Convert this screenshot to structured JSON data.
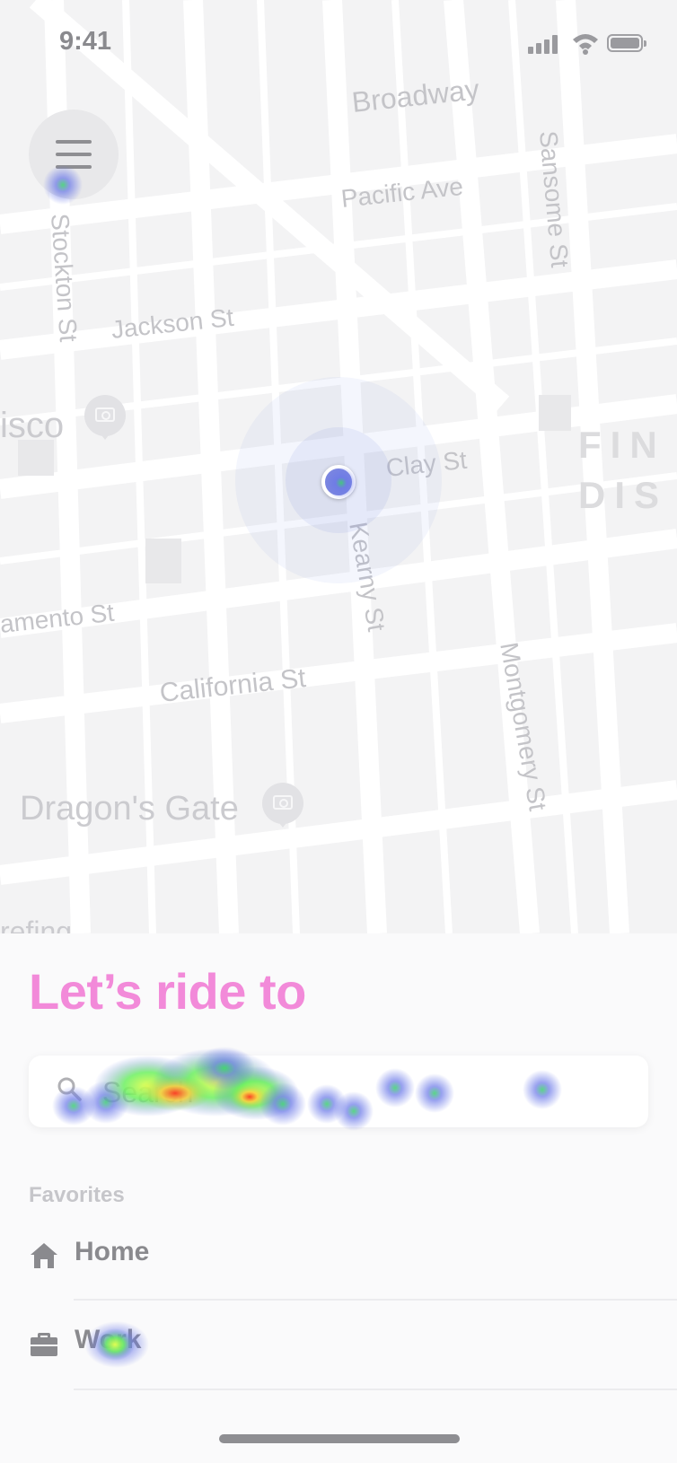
{
  "status_bar": {
    "time": "9:41"
  },
  "map": {
    "street_labels": {
      "broadway": "Broadway",
      "pacific": "Pacific Ave",
      "sansome": "Sansome St",
      "stockton": "Stockton St",
      "jackson": "Jackson St",
      "clay": "Clay St",
      "kearny": "Kearny St",
      "sacramento": "amento St",
      "california": "California St",
      "montgomery": "Montgomery St"
    },
    "poi_labels": {
      "sanfrancisco": "isco",
      "dragons_gate": "Dragon's Gate",
      "bottom_partial": "refing"
    },
    "district_label": "FIN\nDIS"
  },
  "sheet": {
    "title": "Let’s ride to",
    "search_placeholder": "Search",
    "favorites_label": "Favorites",
    "favorites": [
      {
        "label": "Home",
        "icon": "home-icon"
      },
      {
        "label": "Work",
        "icon": "briefcase-icon"
      }
    ]
  },
  "colors": {
    "title_accent": "#f28ad9",
    "location_dot": "#7b86e0"
  }
}
